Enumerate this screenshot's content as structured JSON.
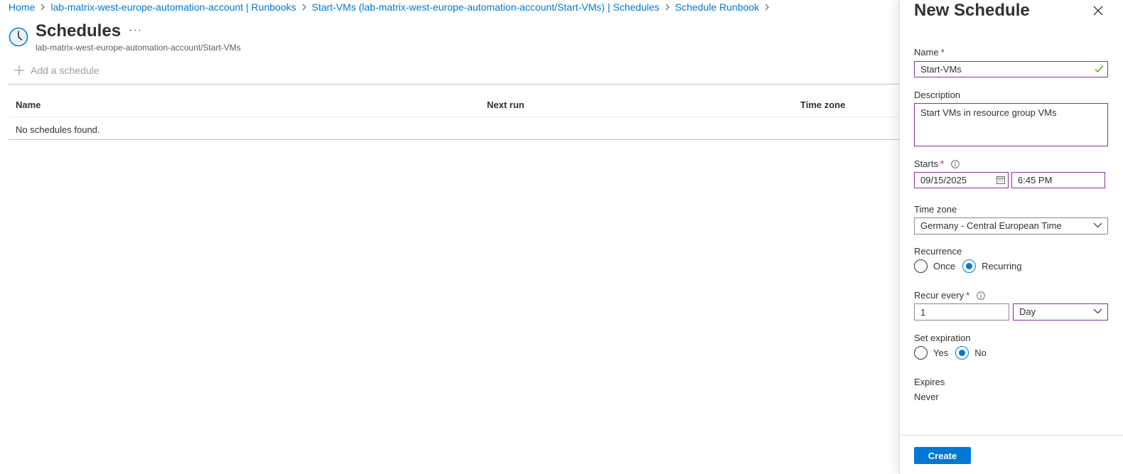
{
  "breadcrumb": {
    "items": [
      "Home",
      "lab-matrix-west-europe-automation-account | Runbooks",
      "Start-VMs (lab-matrix-west-europe-automation-account/Start-VMs) | Schedules",
      "Schedule Runbook"
    ]
  },
  "page": {
    "title": "Schedules",
    "more": "···",
    "subtitle": "lab-matrix-west-europe-automation-account/Start-VMs",
    "icon": "clock-icon"
  },
  "toolbar": {
    "add_label": "Add a schedule"
  },
  "grid": {
    "columns": [
      "Name",
      "Next run",
      "Time zone"
    ],
    "empty_text": "No schedules found."
  },
  "blade": {
    "title": "New Schedule",
    "name": {
      "label": "Name",
      "value": "Start-VMs"
    },
    "description": {
      "label": "Description",
      "value": "Start VMs in resource group VMs"
    },
    "starts": {
      "label": "Starts",
      "date": "09/15/2025",
      "time": "6:45 PM"
    },
    "timezone": {
      "label": "Time zone",
      "value": "Germany - Central European Time"
    },
    "recurrence": {
      "label": "Recurrence",
      "options": [
        "Once",
        "Recurring"
      ],
      "selected": "Recurring"
    },
    "recur_every": {
      "label": "Recur every",
      "value": "1",
      "unit": "Day"
    },
    "set_expiration": {
      "label": "Set expiration",
      "options": [
        "Yes",
        "No"
      ],
      "selected": "No"
    },
    "expires": {
      "label": "Expires",
      "value": "Never"
    },
    "create_label": "Create"
  },
  "colors": {
    "accent": "#0078d4",
    "focus_border": "#8a2da5",
    "required": "#a4262c",
    "valid_check": "#57a300"
  }
}
